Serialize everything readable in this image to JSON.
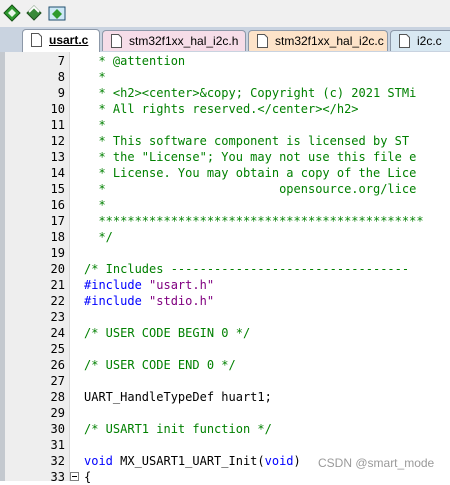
{
  "tabs": [
    {
      "label": "usart.c",
      "active": true,
      "color": "#ffffff"
    },
    {
      "label": "stm32f1xx_hal_i2c.h",
      "active": false,
      "color": "#f6dde8"
    },
    {
      "label": "stm32f1xx_hal_i2c.c",
      "active": false,
      "color": "#fde3c9"
    },
    {
      "label": "i2c.c",
      "active": false,
      "color": "#d8e8f2"
    }
  ],
  "lines": [
    {
      "num": "7",
      "segs": [
        {
          "t": "  * @attention",
          "c": "cmt"
        }
      ]
    },
    {
      "num": "8",
      "segs": [
        {
          "t": "  *",
          "c": "cmt"
        }
      ]
    },
    {
      "num": "9",
      "segs": [
        {
          "t": "  * <h2><center>&copy; Copyright (c) 2021 STMi",
          "c": "cmt"
        }
      ]
    },
    {
      "num": "10",
      "segs": [
        {
          "t": "  * All rights reserved.</center></h2>",
          "c": "cmt"
        }
      ]
    },
    {
      "num": "11",
      "segs": [
        {
          "t": "  *",
          "c": "cmt"
        }
      ]
    },
    {
      "num": "12",
      "segs": [
        {
          "t": "  * This software component is licensed by ST ",
          "c": "cmt"
        }
      ]
    },
    {
      "num": "13",
      "segs": [
        {
          "t": "  * the \"License\"; You may not use this file e",
          "c": "cmt"
        }
      ]
    },
    {
      "num": "14",
      "segs": [
        {
          "t": "  * License. You may obtain a copy of the Lice",
          "c": "cmt"
        }
      ]
    },
    {
      "num": "15",
      "segs": [
        {
          "t": "  *                        opensource.org/lice",
          "c": "cmt"
        }
      ]
    },
    {
      "num": "16",
      "segs": [
        {
          "t": "  *",
          "c": "cmt"
        }
      ]
    },
    {
      "num": "17",
      "segs": [
        {
          "t": "  *********************************************",
          "c": "cmt"
        }
      ]
    },
    {
      "num": "18",
      "segs": [
        {
          "t": "  */",
          "c": "cmt"
        }
      ]
    },
    {
      "num": "19",
      "segs": []
    },
    {
      "num": "20",
      "segs": [
        {
          "t": "/* Includes ---------------------------------",
          "c": "cmt"
        }
      ]
    },
    {
      "num": "21",
      "segs": [
        {
          "t": "#include ",
          "c": "pp"
        },
        {
          "t": "\"usart.h\"",
          "c": "str"
        }
      ]
    },
    {
      "num": "22",
      "segs": [
        {
          "t": "#include ",
          "c": "pp"
        },
        {
          "t": "\"stdio.h\"",
          "c": "str"
        }
      ]
    },
    {
      "num": "23",
      "segs": []
    },
    {
      "num": "24",
      "segs": [
        {
          "t": "/* USER CODE BEGIN 0 */",
          "c": "cmt"
        }
      ]
    },
    {
      "num": "25",
      "segs": []
    },
    {
      "num": "26",
      "segs": [
        {
          "t": "/* USER CODE END 0 */",
          "c": "cmt"
        }
      ]
    },
    {
      "num": "27",
      "segs": []
    },
    {
      "num": "28",
      "segs": [
        {
          "t": "UART_HandleTypeDef huart1;",
          "c": ""
        }
      ]
    },
    {
      "num": "29",
      "segs": []
    },
    {
      "num": "30",
      "segs": [
        {
          "t": "/* USART1 init function */",
          "c": "cmt"
        }
      ]
    },
    {
      "num": "31",
      "segs": []
    },
    {
      "num": "32",
      "segs": [
        {
          "t": "void",
          "c": "kw"
        },
        {
          "t": " MX_USART1_UART_Init(",
          "c": ""
        },
        {
          "t": "void",
          "c": "kw"
        },
        {
          "t": ")",
          "c": ""
        }
      ]
    },
    {
      "num": "33",
      "segs": [
        {
          "t": "{",
          "c": ""
        }
      ]
    }
  ],
  "watermark": "CSDN @smart_mode"
}
